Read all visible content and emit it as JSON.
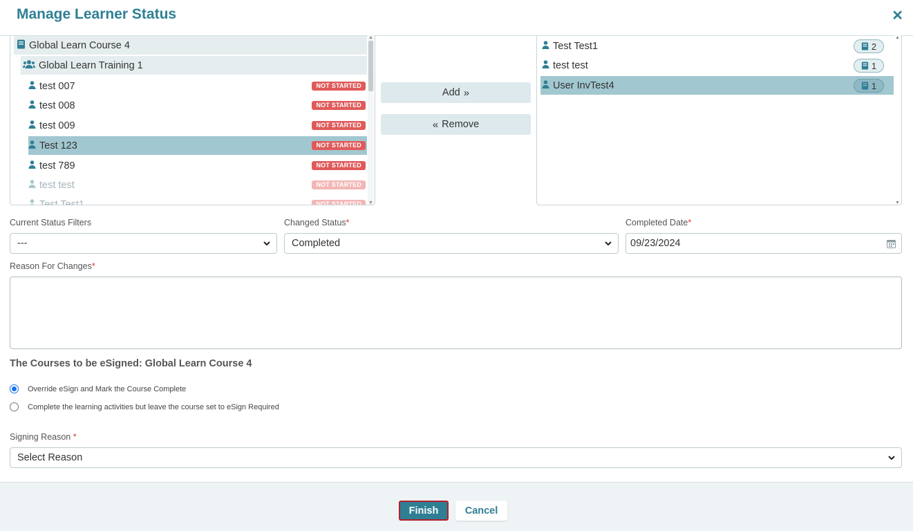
{
  "header": {
    "title": "Manage Learner Status"
  },
  "left_list": {
    "course": "Global Learn Course 4",
    "training": "Global Learn Training 1",
    "learners": [
      {
        "name": "test 007",
        "status": "NOT STARTED"
      },
      {
        "name": "test 008",
        "status": "NOT STARTED"
      },
      {
        "name": "test 009",
        "status": "NOT STARTED"
      },
      {
        "name": "Test 123",
        "status": "NOT STARTED"
      },
      {
        "name": "test 789",
        "status": "NOT STARTED"
      },
      {
        "name": "test test",
        "status": "NOT STARTED"
      },
      {
        "name": "Test Test1",
        "status": "NOT STARTED"
      }
    ]
  },
  "actions": {
    "add_label": "Add",
    "remove_label": "Remove"
  },
  "right_list": {
    "users": [
      {
        "name": "Test Test1",
        "count": "2"
      },
      {
        "name": "test test",
        "count": "1"
      },
      {
        "name": "User InvTest4",
        "count": "1"
      }
    ]
  },
  "form": {
    "current_status_label": "Current Status Filters",
    "current_status_value": "---",
    "changed_status_label": "Changed Status",
    "changed_status_value": "Completed",
    "completed_date_label": "Completed Date",
    "completed_date_value": "09/23/2024",
    "reason_label": "Reason For Changes",
    "required_mark": "*"
  },
  "esign": {
    "title": "The Courses to be eSigned: Global Learn Course 4",
    "option_1": "Override eSign and Mark the Course Complete",
    "option_2": "Complete the learning activities but leave the course set to eSign Required",
    "signing_reason_label": "Signing Reason",
    "signing_reason_value": "Select Reason"
  },
  "footer": {
    "finish_label": "Finish",
    "cancel_label": "Cancel"
  },
  "colors": {
    "accent": "#2f7f94",
    "selected_row": "#a1c7d0",
    "not_started_badge": "#e05a5a",
    "finish_border": "#b3202a"
  }
}
